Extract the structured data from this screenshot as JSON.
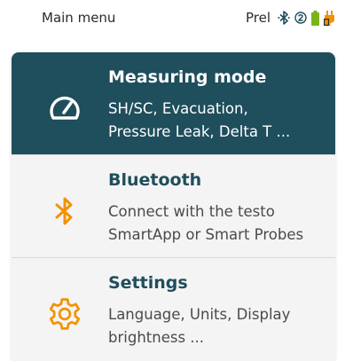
{
  "statusbar": {
    "title": "Main menu",
    "prel": "Prel",
    "icons": [
      "bluetooth-icon",
      "probe-2-icon",
      "battery-icon",
      "power-plug-icon"
    ],
    "colors": {
      "bluetooth": "#1f4e5c",
      "battery": "#7ab317",
      "plug": "#f39200"
    }
  },
  "menu": {
    "items": [
      {
        "title": "Measuring mode",
        "desc_line1": "SH/SC, Evacuation,",
        "desc_line2": "Pressure Leak, Delta T ...",
        "icon": "gauge-icon",
        "active": true
      },
      {
        "title": "Bluetooth",
        "desc_line1": "Connect with the testo",
        "desc_line2": "SmartApp or Smart Probes",
        "icon": "bluetooth-icon",
        "active": false
      },
      {
        "title": "Settings",
        "desc_line1": "Language, Units, Display",
        "desc_line2": "brightness ...",
        "icon": "gear-icon",
        "active": false
      }
    ],
    "colors": {
      "active_bg": "#1f4e5c",
      "accent": "#f39200",
      "title": "#1f4e5c"
    }
  }
}
